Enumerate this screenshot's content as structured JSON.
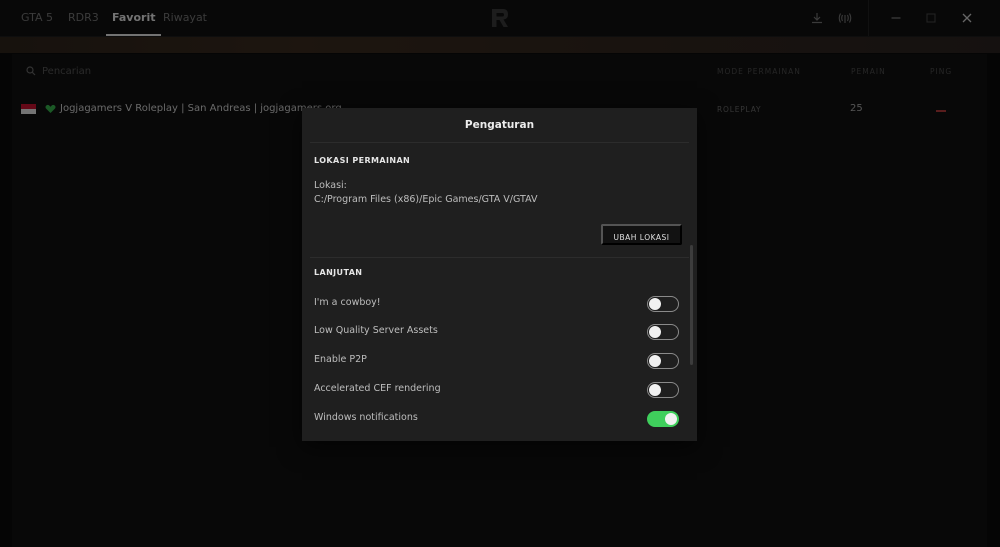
{
  "tabs": [
    {
      "label": "GTA 5",
      "active": false
    },
    {
      "label": "RDR3",
      "active": false
    },
    {
      "label": "Favorit",
      "active": true
    },
    {
      "label": "Riwayat",
      "active": false
    }
  ],
  "header_icons": [
    "download-icon",
    "broadcast-icon",
    "minimize-icon",
    "maximize-icon",
    "close-icon"
  ],
  "search": {
    "placeholder": "Pencarian"
  },
  "columns": {
    "mode": "MODE PERMAINAN",
    "players": "PEMAIN",
    "ping": "PING"
  },
  "servers": [
    {
      "name": "Jogjagamers V Roleplay | San Andreas | jogjagamers.org",
      "mode": "ROLEPLAY",
      "players": "25",
      "favorite": true,
      "flag": "indonesia"
    }
  ],
  "settings": {
    "title": "Pengaturan",
    "location_section": "LOKASI PERMAINAN",
    "location_label": "Lokasi:",
    "location_path": "C:/Program Files (x86)/Epic Games/GTA V/GTAV",
    "change_location_button": "UBAH LOKASI",
    "advanced_section": "LANJUTAN",
    "options": [
      {
        "label": "I'm a cowboy!",
        "enabled": false
      },
      {
        "label": "Low Quality Server Assets",
        "enabled": false
      },
      {
        "label": "Enable P2P",
        "enabled": false
      },
      {
        "label": "Accelerated CEF rendering",
        "enabled": false
      },
      {
        "label": "Windows notifications",
        "enabled": true
      }
    ]
  },
  "colors": {
    "accent_green": "#3fcf5c",
    "modal_bg": "#1f1f1f",
    "background": "#0b0b0b"
  }
}
